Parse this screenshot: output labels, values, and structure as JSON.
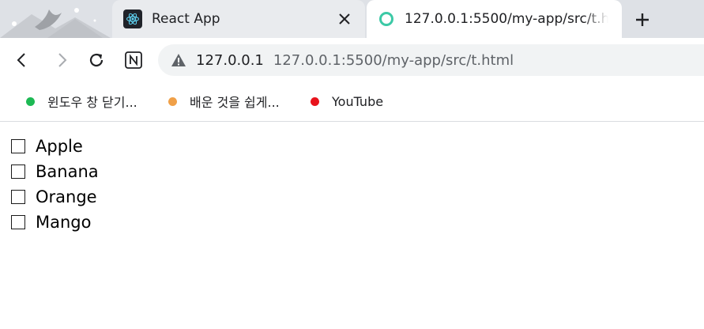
{
  "tabs": [
    {
      "title": "React App",
      "active": false,
      "favicon": "react-logo-icon"
    },
    {
      "title": "127.0.0.1:5500/my-app/src/t.html",
      "active": true,
      "favicon": "loading-icon"
    }
  ],
  "toolbar": {
    "host": "127.0.0.1",
    "url": "127.0.0.1:5500/my-app/src/t.html",
    "security_icon": "warning-icon"
  },
  "bookmarks": [
    {
      "label": "윈도우 창 닫기...",
      "color": "#1db954"
    },
    {
      "label": "배운 것을 쉽게...",
      "color": "#f0a048"
    },
    {
      "label": "YouTube",
      "color": "#e8131c"
    }
  ],
  "fruits": [
    {
      "label": "Apple",
      "checked": false
    },
    {
      "label": "Banana",
      "checked": false
    },
    {
      "label": "Orange",
      "checked": false
    },
    {
      "label": "Mango",
      "checked": false
    }
  ],
  "colors": {
    "tabstrip": "#dee1e6",
    "omnibox": "#f1f3f4",
    "loading_ring": "#3cc9a6"
  }
}
